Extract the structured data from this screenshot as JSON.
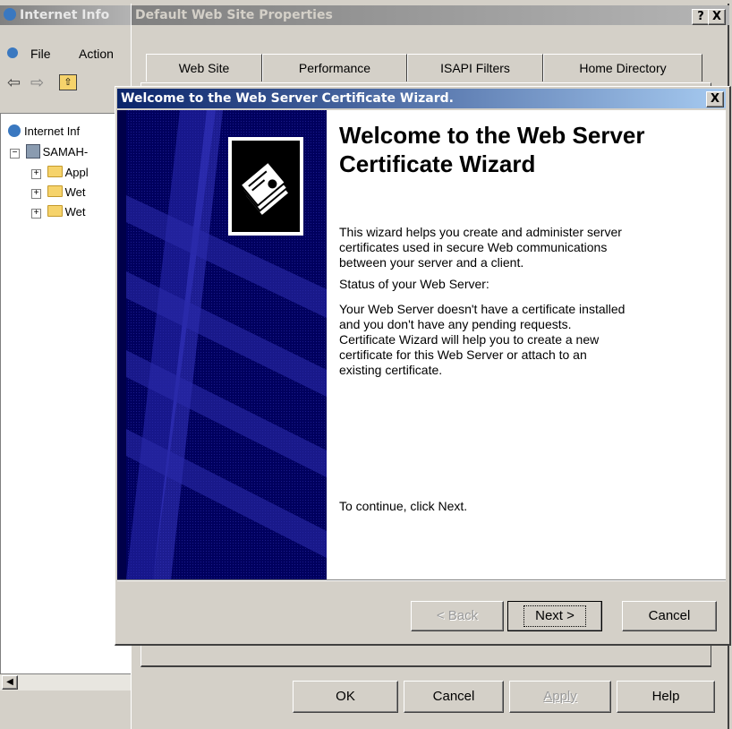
{
  "main_window": {
    "title": "Internet Info",
    "menu": [
      {
        "label": "File"
      },
      {
        "label": "Action"
      }
    ],
    "tree": {
      "root": "Internet Inf",
      "server": "SAMAH-",
      "children": [
        "Appl",
        "Wet",
        "Wet"
      ]
    }
  },
  "properties_dialog": {
    "title": "Default Web Site Properties",
    "help_button": "?",
    "close_button": "X",
    "tabs": [
      "Web Site",
      "Performance",
      "ISAPI Filters",
      "Home Directory"
    ],
    "buttons": {
      "ok": "OK",
      "cancel": "Cancel",
      "apply": "Apply",
      "help": "Help"
    }
  },
  "wizard": {
    "title": "Welcome to the Web Server Certificate Wizard.",
    "close_button": "X",
    "heading_line1": "Welcome to the Web Server",
    "heading_line2": "Certificate Wizard",
    "intro_line1": "This wizard helps you create and administer server",
    "intro_line2": "certificates used in secure Web communications",
    "intro_line3": "between your server and a client.",
    "status_label": "Status of your Web Server:",
    "status_line1": "Your Web Server doesn't have a certificate installed",
    "status_line2": "and you don't have any pending requests.",
    "status_line3": "Certificate Wizard will help you to create a new",
    "status_line4": "certificate for this Web Server or attach to an",
    "status_line5": "existing certificate.",
    "continue_text": "To continue, click Next.",
    "buttons": {
      "back": "< Back",
      "next": "Next >",
      "cancel": "Cancel"
    },
    "colors": {
      "banner": "#000080",
      "title_active": "#0a246a"
    }
  }
}
